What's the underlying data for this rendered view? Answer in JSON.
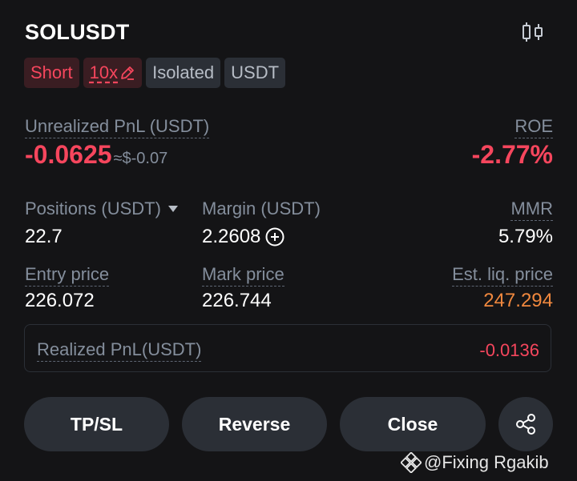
{
  "header": {
    "symbol": "SOLUSDT",
    "chart_icon": "candlestick-chart-icon"
  },
  "tags": {
    "side": "Short",
    "leverage": "10x",
    "leverage_icon": "edit-pencil-icon",
    "margin_mode": "Isolated",
    "settle_currency": "USDT"
  },
  "pnl": {
    "label": "Unrealized PnL (USDT)",
    "value": "-0.0625",
    "usd_approx": "≈$-0.07",
    "roe_label": "ROE",
    "roe_value": "-2.77%"
  },
  "stats": {
    "positions_label": "Positions (USDT)",
    "positions_value": "22.7",
    "margin_label": "Margin (USDT)",
    "margin_value": "2.2608",
    "mmr_label": "MMR",
    "mmr_value": "5.79%",
    "entry_label": "Entry price",
    "entry_value": "226.072",
    "mark_label": "Mark price",
    "mark_value": "226.744",
    "liq_label": "Est. liq. price",
    "liq_value": "247.294"
  },
  "realized": {
    "label": "Realized PnL(USDT)",
    "value": "-0.0136"
  },
  "actions": {
    "tpsl": "TP/SL",
    "reverse": "Reverse",
    "close": "Close",
    "share_icon": "share-icon"
  },
  "watermark": "@Fixing Rgakib",
  "colors": {
    "background": "#141416",
    "negative": "#f6465d",
    "liquidation": "#f0883e",
    "muted": "#848e9c",
    "button": "#2b2f36"
  }
}
